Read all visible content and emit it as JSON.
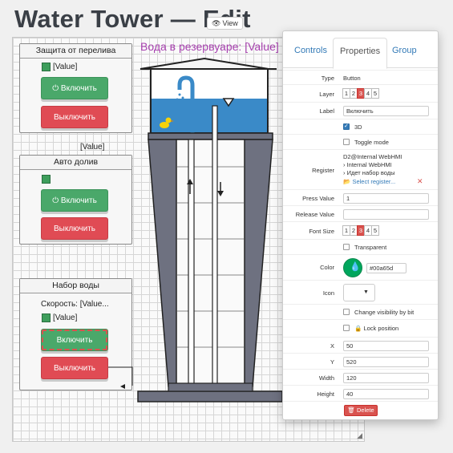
{
  "header": {
    "title": "Water Tower — Edit",
    "view_label": "View"
  },
  "canvas": {
    "tower_title": "Вода в резервуаре: [Value]",
    "overflow_group": {
      "title": "Защита от перелива",
      "value": "[Value]",
      "on_label": "Включить",
      "off_label": "Выключить"
    },
    "floating_value": "[Value]",
    "autofill_group": {
      "title": "Авто долив",
      "on_label": "Включить",
      "off_label": "Выключить"
    },
    "fill_group": {
      "title": "Набор воды",
      "speed": "Скорость: [Value...",
      "value": "[Value]",
      "on_label": "Включить",
      "off_label": "Выключить"
    },
    "colors": {
      "water": "#3a8ac8",
      "tower": "#6e7180",
      "accent": "#a63fae"
    },
    "icons": [
      "power-icon",
      "duck-icon",
      "arrow-up-icon",
      "arrow-down-icon",
      "resize-grip-icon"
    ]
  },
  "panel": {
    "tabs": [
      "Controls",
      "Properties",
      "Group"
    ],
    "active_tab": "Properties",
    "type_label": "Type",
    "type_value": "Button",
    "layer_label": "Layer",
    "layer_options": [
      "1",
      "2",
      "3",
      "4",
      "5"
    ],
    "layer_selected": "3",
    "label_label": "Label",
    "label_value": "Включить",
    "threed_label": "3D",
    "threed_checked": true,
    "toggle_label": "Toggle mode",
    "toggle_checked": false,
    "register_label": "Register",
    "register_path": [
      "D2@Internal WebHMI",
      "Internal WebHMI",
      "Идет набор воды"
    ],
    "register_select": "Select register...",
    "press_label": "Press Value",
    "press_value": "1",
    "release_label": "Release Value",
    "release_value": "",
    "fontsize_label": "Font Size",
    "fontsize_options": [
      "1",
      "2",
      "3",
      "4",
      "5"
    ],
    "fontsize_selected": "3",
    "transparent_label": "Transparent",
    "transparent_checked": false,
    "color_label": "Color",
    "color_value": "#00a65d",
    "icon_label": "Icon",
    "visibility_label": "Change visibility by bit",
    "visibility_checked": false,
    "lock_label": "Lock position",
    "lock_checked": false,
    "x_label": "X",
    "x_value": "50",
    "y_label": "Y",
    "y_value": "520",
    "width_label": "Width",
    "width_value": "120",
    "height_label": "Height",
    "height_value": "40",
    "delete_label": "Delete"
  }
}
